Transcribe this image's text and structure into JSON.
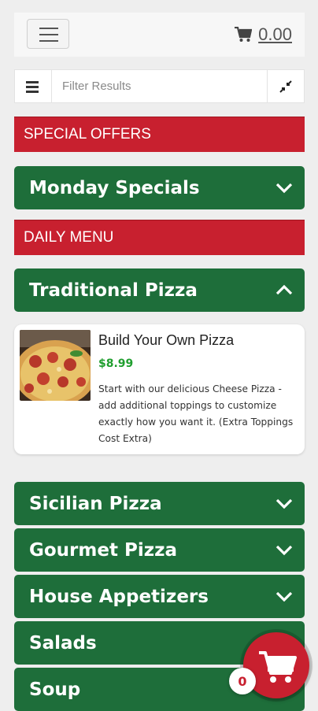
{
  "header": {
    "cart_total": "0.00"
  },
  "filter": {
    "placeholder": "Filter Results"
  },
  "sections": {
    "special_offers": "SPECIAL OFFERS",
    "daily_menu": "DAILY MENU"
  },
  "categories": {
    "monday_specials": "Monday Specials",
    "traditional_pizza": "Traditional Pizza",
    "sicilian_pizza": "Sicilian Pizza",
    "gourmet_pizza": "Gourmet Pizza",
    "house_appetizers": "House Appetizers",
    "salads": "Salads",
    "soup": "Soup"
  },
  "item": {
    "name": "Build Your Own Pizza",
    "price": "$8.99",
    "description": "Start with our delicious Cheese Pizza - add additional toppings to customize exactly how you want it. (Extra Toppings Cost Extra)"
  },
  "cart_fab": {
    "count": "0"
  },
  "colors": {
    "red": "#c8202f",
    "green": "#1e6e3a",
    "price_green": "#1f9e2e"
  },
  "icons": [
    "hamburger-menu-icon",
    "cart-icon",
    "list-icon",
    "collapse-icon",
    "chevron-down-icon",
    "chevron-up-icon",
    "pizza-photo"
  ]
}
